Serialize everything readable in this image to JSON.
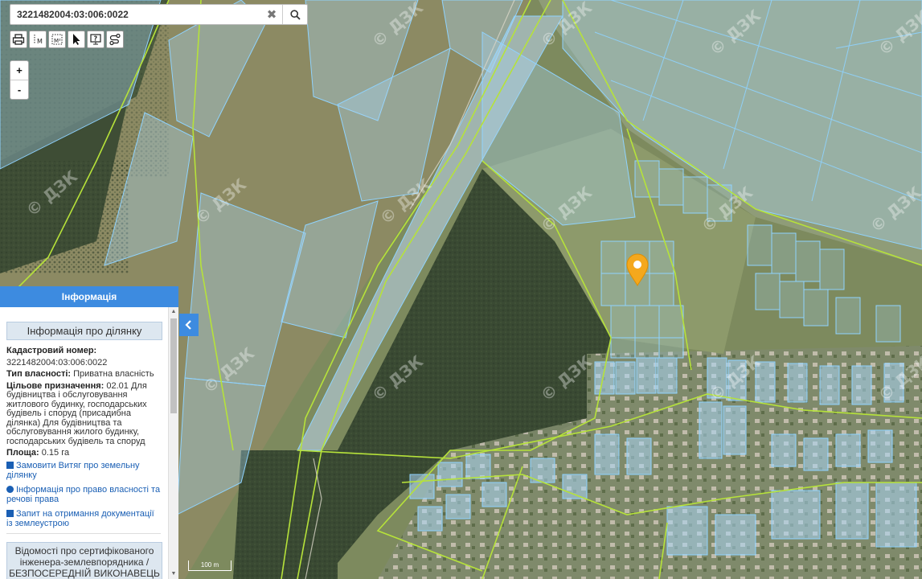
{
  "search": {
    "value": "3221482004:03:006:0022",
    "clear_glyph": "✖"
  },
  "toolbar": {
    "tools": [
      "print-icon",
      "measure-length-icon",
      "measure-area-icon",
      "select-pointer-icon",
      "identify-help-icon",
      "route-icon"
    ]
  },
  "zoom": {
    "in": "+",
    "out": "-"
  },
  "watermark": "© ДЗК",
  "panel": {
    "title": "Інформація",
    "section_title": "Інформація про ділянку",
    "cadastral_label": "Кадастровий номер:",
    "cadastral_value": "3221482004:03:006:0022",
    "ownership_label": "Тип власності:",
    "ownership_value": " Приватна власність",
    "purpose_label": "Цільове призначення:",
    "purpose_value": " 02.01 Для будівництва і обслуговування житлового будинку, господарських будівель і споруд (присадибна ділянка) Для будівництва та обслуговування жилого будинку, господарських будівель та споруд",
    "area_label": "Площа:",
    "area_value": " 0.15 га",
    "links": [
      "Замовити Витяг про земельну ділянку",
      "Інформація про право власності та речові права",
      "Запит на отримання документації із землеустрою"
    ],
    "engineer_box": "Відомості про сертифікованого інженера-землевпорядника / БЕЗПОСЕРЕДНІЙ ВИКОНАВЕЦЬ"
  },
  "scale": {
    "label": "100 m"
  },
  "colors": {
    "panel_header": "#3d8be0",
    "parcel_stroke": "#8fd3ff",
    "boundary_stroke": "#b6e23a",
    "marker": "#f4a81d"
  }
}
